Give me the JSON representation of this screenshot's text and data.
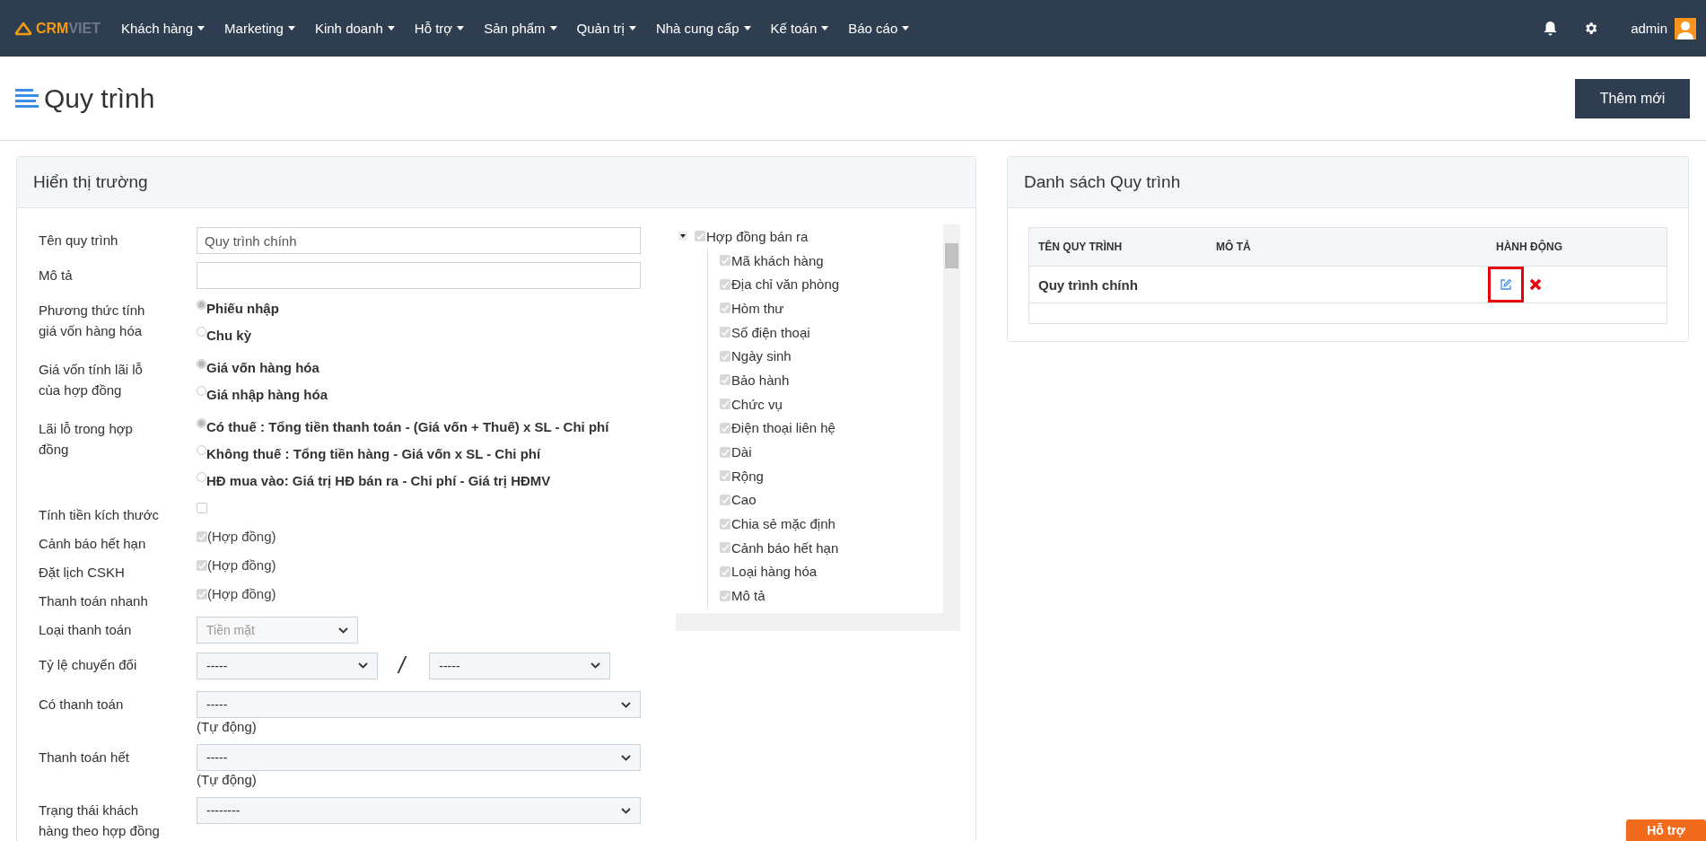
{
  "nav": {
    "logo_primary": "CRM",
    "logo_secondary": "VIET",
    "menu": [
      {
        "label": "Khách hàng"
      },
      {
        "label": "Marketing"
      },
      {
        "label": "Kinh doanh"
      },
      {
        "label": "Hỗ trợ"
      },
      {
        "label": "Sản phẩm"
      },
      {
        "label": "Quản trị"
      },
      {
        "label": "Nhà cung cấp"
      },
      {
        "label": "Kế toán"
      },
      {
        "label": "Báo cáo"
      }
    ],
    "user": "admin"
  },
  "page": {
    "title": "Quy trình",
    "add_button": "Thêm mới"
  },
  "form_panel": {
    "title": "Hiển thị trường",
    "fields": [
      {
        "kind": "text",
        "label": "Tên quy trình",
        "value": "Quy trình chính"
      },
      {
        "kind": "text",
        "label": "Mô tả"
      },
      {
        "kind": "radio",
        "label": "Phương thức tính giá vốn hàng hóa",
        "options": [
          {
            "label": "Phiếu nhập",
            "selected": true
          },
          {
            "label": "Chu kỳ",
            "selected": false
          }
        ]
      },
      {
        "kind": "radio",
        "label": "Giá vốn tính lãi lỗ của hợp đồng",
        "options": [
          {
            "label": "Giá vốn hàng hóa",
            "selected": true
          },
          {
            "label": "Giá nhập hàng hóa",
            "selected": false
          }
        ]
      },
      {
        "kind": "radio",
        "label": "Lãi lỗ trong hợp đồng",
        "options": [
          {
            "label": "Có thuế : Tổng tiền thanh toán - (Giá vốn + Thuế) x SL - Chi phí",
            "selected": true
          },
          {
            "label": "Không thuế : Tổng tiền hàng - Giá vốn x SL - Chi phí",
            "selected": false
          },
          {
            "label": "HĐ mua vào: Giá trị HĐ bán ra - Chi phí - Giá trị HĐMV",
            "selected": false
          }
        ]
      },
      {
        "kind": "checkbox",
        "label": "Tính tiền kích thước",
        "checked": false
      },
      {
        "kind": "checkbox",
        "label": "Cảnh báo hết hạn",
        "checked": true,
        "note": "(Hợp đồng)"
      },
      {
        "kind": "checkbox",
        "label": "Đặt lịch CSKH",
        "checked": true,
        "note": "(Hợp đồng)"
      },
      {
        "kind": "checkbox",
        "label": "Thanh toán nhanh",
        "checked": true,
        "note": "(Hợp đồng)"
      },
      {
        "kind": "short_select",
        "label": "Loại thanh toán",
        "value": "Tiền mặt",
        "disabled": true
      },
      {
        "kind": "select_pair",
        "label": "Tỷ lệ chuyển đổi",
        "value": "-----",
        "separator": "/",
        "value_2": "-----"
      },
      {
        "kind": "select",
        "label": "Có thanh toán",
        "value": "-----",
        "disabled": false,
        "note": "(Tự động)"
      },
      {
        "kind": "select",
        "label": "Thanh toán hết",
        "value": "-----",
        "disabled": false,
        "note": "(Tự động)"
      },
      {
        "kind": "select",
        "label": "Trạng thái khách hàng theo hợp đồng",
        "value": "--------",
        "disabled": false
      }
    ],
    "tree": {
      "label": "Hợp đồng bán ra",
      "checked": true,
      "expanded": true,
      "children": [
        {
          "label": "Mã khách hàng",
          "checked": true
        },
        {
          "label": "Địa chỉ văn phòng",
          "checked": true
        },
        {
          "label": "Hòm thư",
          "checked": true
        },
        {
          "label": "Số điện thoại",
          "checked": true
        },
        {
          "label": "Ngày sinh",
          "checked": true
        },
        {
          "label": "Bảo hành",
          "checked": true
        },
        {
          "label": "Chức vụ",
          "checked": true
        },
        {
          "label": "Điện thoại liên hệ",
          "checked": true
        },
        {
          "label": "Dài",
          "checked": true
        },
        {
          "label": "Rộng",
          "checked": true
        },
        {
          "label": "Cao",
          "checked": true
        },
        {
          "label": "Chia sẻ mặc định",
          "checked": true
        },
        {
          "label": "Cảnh báo hết hạn",
          "checked": true
        },
        {
          "label": "Loại hàng hóa",
          "checked": true
        },
        {
          "label": "Mô tả",
          "checked": true
        }
      ]
    }
  },
  "list_panel": {
    "title": "Danh sách Quy trình",
    "columns": [
      "TÊN QUY TRÌNH",
      "MÔ TẢ",
      "HÀNH ĐỘNG"
    ],
    "rows": [
      {
        "name": "Quy trình chính",
        "edit_highlighted": true
      }
    ]
  },
  "help_tab": "Hỗ trợ"
}
